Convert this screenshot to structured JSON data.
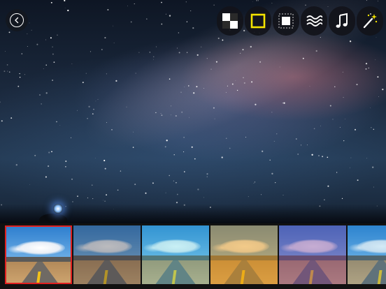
{
  "app": {
    "canvas": {
      "scene": "milky-way-night-sky",
      "accent_colors": {
        "sky_top": "#0e1624",
        "glow": "#be6e78",
        "lamp": "#8fc3ff"
      }
    }
  },
  "topbar": {
    "back_button": {
      "icon": "chevron-left-icon"
    },
    "tools": [
      {
        "id": "pattern",
        "icon": "checkerboard-icon",
        "active": false
      },
      {
        "id": "frame",
        "icon": "frame-square-icon",
        "active": true,
        "color": "#f5e400"
      },
      {
        "id": "crop",
        "icon": "crop-square-icon",
        "active": false
      },
      {
        "id": "effects",
        "icon": "waves-icon",
        "active": false
      },
      {
        "id": "music",
        "icon": "music-note-icon",
        "active": false
      },
      {
        "id": "magic",
        "icon": "magic-wand-icon",
        "active": false
      }
    ]
  },
  "filter_strip": {
    "selected_index": 0,
    "selected_border": "#e02020",
    "filters": [
      {
        "id": "original",
        "tint": "rgba(0,0,0,0)"
      },
      {
        "id": "faded",
        "tint": "rgba(60,60,70,0.35)"
      },
      {
        "id": "cyan",
        "tint": "rgba(60,200,220,0.28)"
      },
      {
        "id": "golden",
        "tint": "rgba(230,150,20,0.5)"
      },
      {
        "id": "purple",
        "tint": "rgba(120,60,150,0.42)"
      },
      {
        "id": "cool",
        "tint": "rgba(40,150,210,0.2)"
      }
    ]
  }
}
